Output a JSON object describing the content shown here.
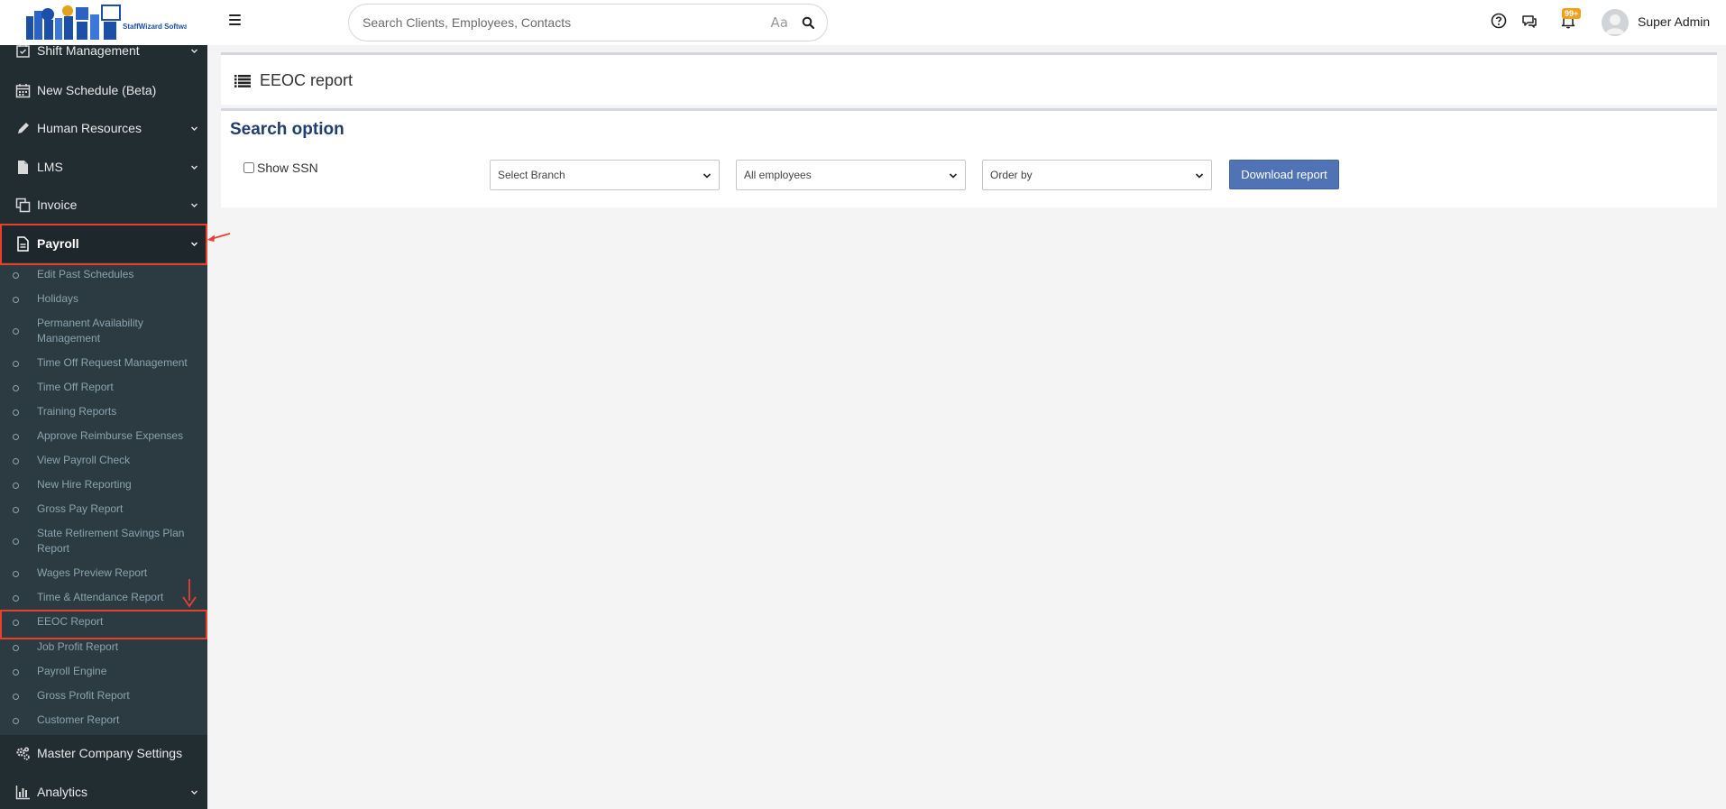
{
  "app": {
    "logo_text": "StaffWizard Software"
  },
  "header": {
    "search_placeholder": "Search Clients, Employees, Contacts",
    "case_toggle": "Aa",
    "notification_count": "99+",
    "user_name": "Super Admin"
  },
  "sidebar": {
    "items": [
      {
        "label": "Shift Management",
        "icon": "calendar-check-icon"
      },
      {
        "label": "New Schedule (Beta)",
        "icon": "calendar-icon"
      },
      {
        "label": "Human Resources",
        "icon": "pencil-icon"
      },
      {
        "label": "LMS",
        "icon": "file-icon"
      },
      {
        "label": "Invoice",
        "icon": "copy-icon"
      },
      {
        "label": "Payroll",
        "icon": "document-icon"
      },
      {
        "label": "Master Company Settings",
        "icon": "gears-icon"
      },
      {
        "label": "Analytics",
        "icon": "bar-chart-icon"
      }
    ],
    "payroll_submenu": [
      "Edit Past Schedules",
      "Holidays",
      "Permanent Availability Management",
      "Time Off Request Management",
      "Time Off Report",
      "Training Reports",
      "Approve Reimburse Expenses",
      "View Payroll Check",
      "New Hire Reporting",
      "Gross Pay Report",
      "State Retirement Savings Plan Report",
      "Wages Preview Report",
      "Time & Attendance Report",
      "EEOC Report",
      "Job Profit Report",
      "Payroll Engine",
      "Gross Profit Report",
      "Customer Report"
    ]
  },
  "main": {
    "title": "EEOC report",
    "search_heading": "Search option",
    "show_ssn_label": "Show SSN",
    "branch_select": "Select Branch",
    "employees_select": "All employees",
    "order_select": "Order by",
    "download_label": "Download report"
  },
  "colors": {
    "sidebar_bg": "#222d32",
    "submenu_bg": "#2c3b41",
    "accent_button": "#4f73b5",
    "highlight_annotation": "#e8402c",
    "badge": "#f0a01c"
  }
}
